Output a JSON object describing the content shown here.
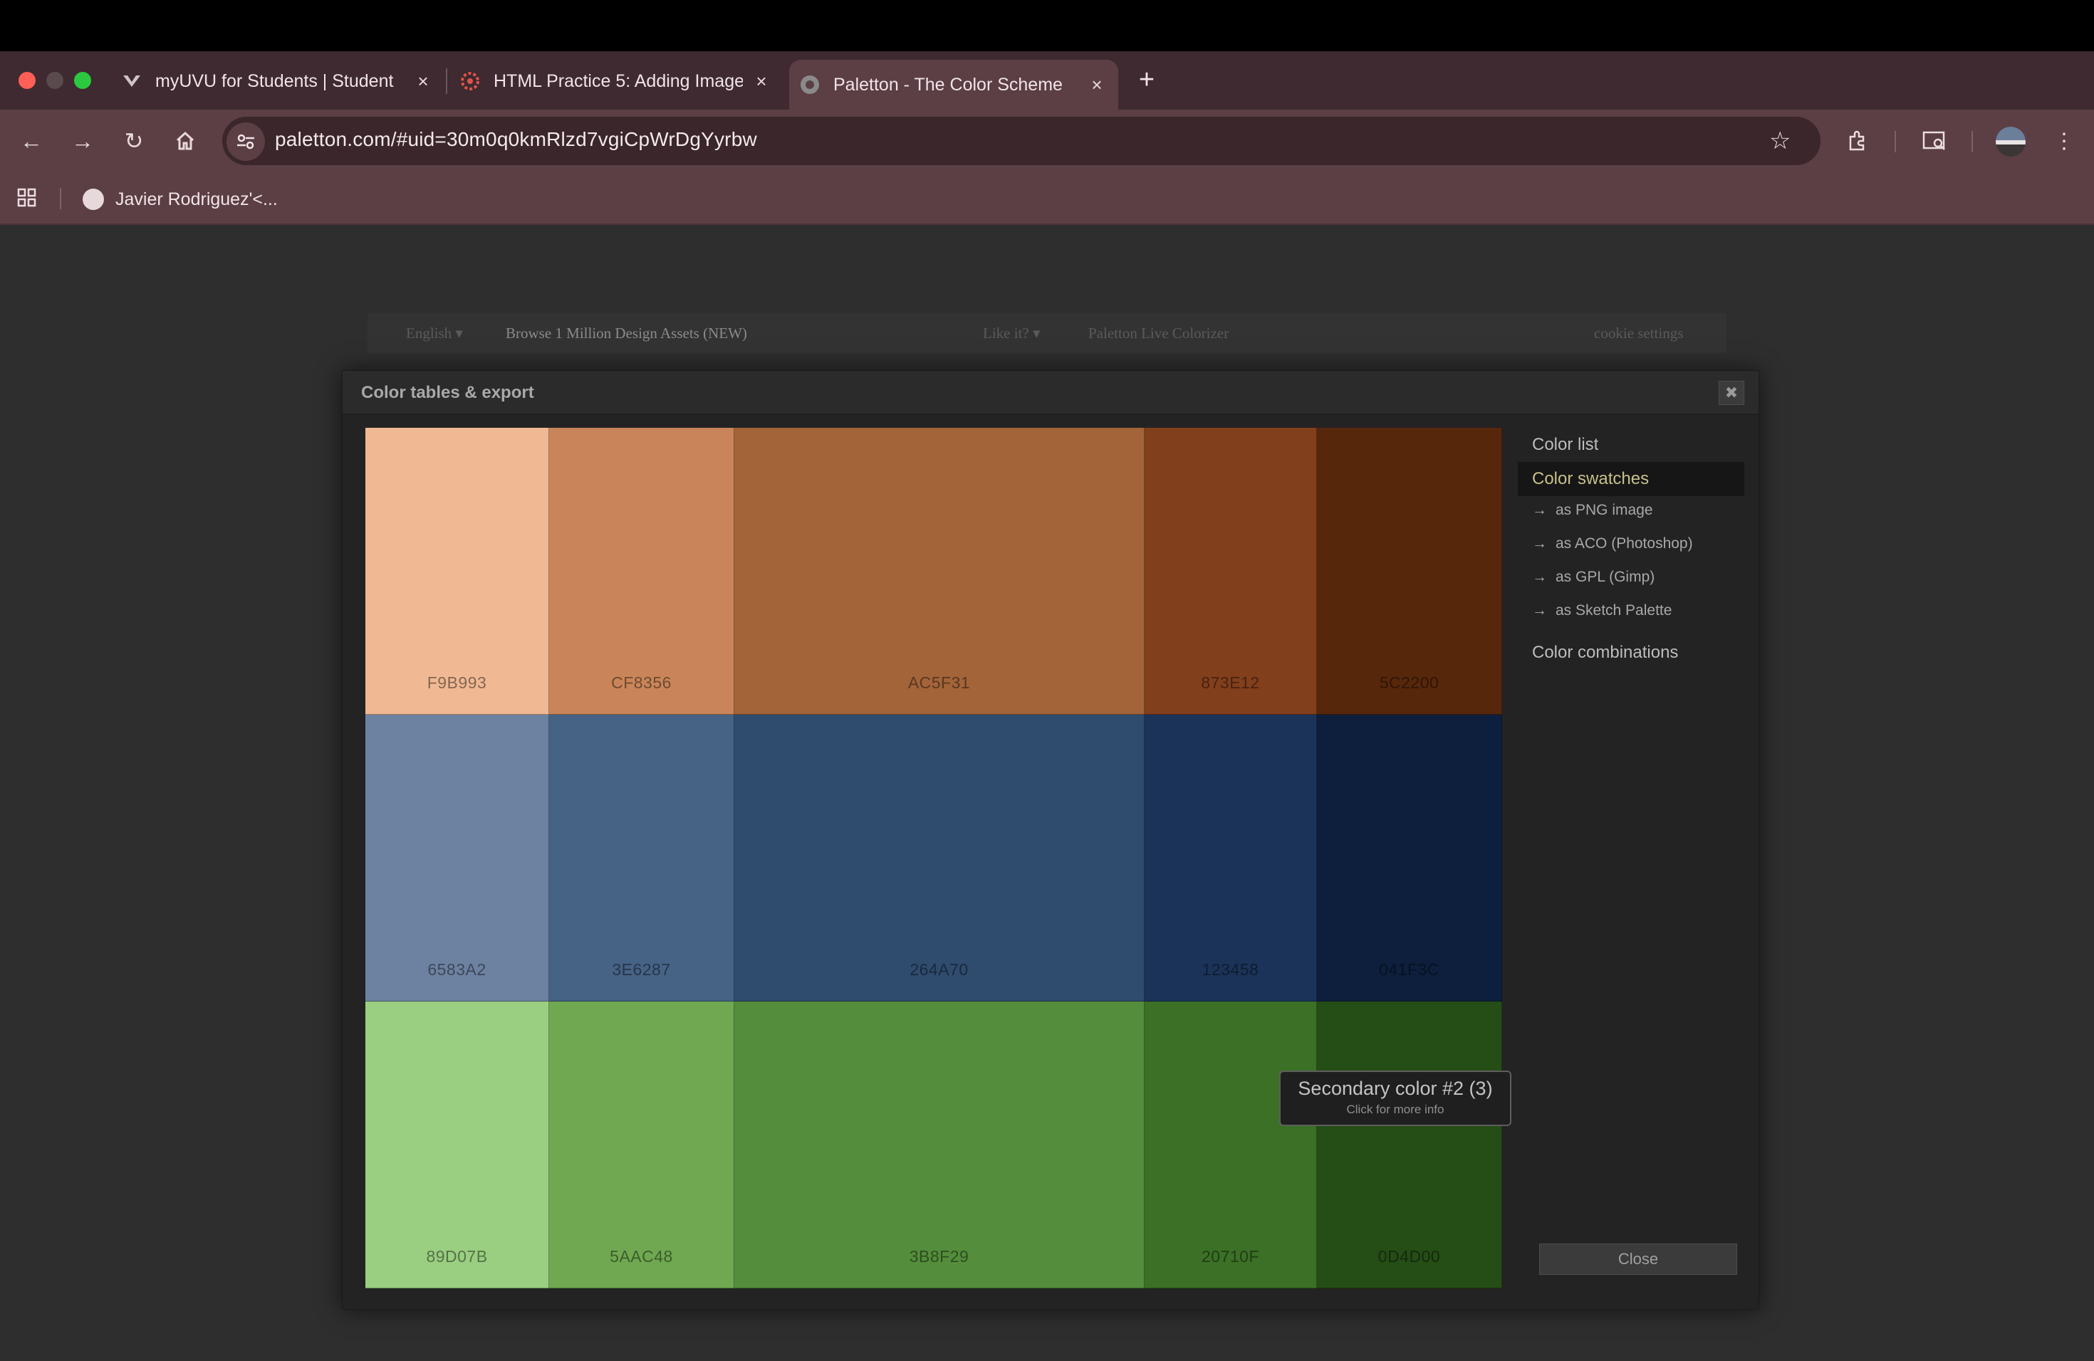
{
  "browser": {
    "tabs": [
      {
        "title": "myUVU for Students | Student",
        "favicon": "uvu-icon"
      },
      {
        "title": "HTML Practice 5: Adding Image",
        "favicon": "canvas-icon"
      },
      {
        "title": "Paletton - The Color Scheme",
        "favicon": "paletton-icon",
        "active": true
      }
    ],
    "url": "paletton.com/#uid=30m0q0kmRlzd7vgiCpWrDgYyrbw",
    "bookmarks": [
      {
        "label": "Javier Rodriguez'<..."
      }
    ]
  },
  "site_nav": {
    "language": "English",
    "assets": "Browse 1 Million Design Assets (NEW)",
    "like": "Like it?",
    "colorizer": "Paletton Live Colorizer",
    "cookie": "cookie settings"
  },
  "modal": {
    "title": "Color tables & export",
    "close_x": "✖",
    "close_label": "Close",
    "sidebar": {
      "color_list": "Color list",
      "color_swatches": "Color swatches",
      "exports": [
        "as PNG image",
        "as ACO (Photoshop)",
        "as GPL (Gimp)",
        "as Sketch Palette"
      ],
      "color_combinations": "Color combinations"
    },
    "swatch_rows": [
      {
        "colors": [
          "F9B993",
          "CF8356",
          "AC5F31",
          "873E12",
          "5C2200"
        ],
        "hex": [
          "#F0B993",
          "#C98559",
          "#A3643A",
          "#823F1C",
          "#57270C"
        ]
      },
      {
        "colors": [
          "6583A2",
          "3E6287",
          "264A70",
          "123458",
          "041F3C"
        ],
        "hex": [
          "#6D82A0",
          "#466285",
          "#2F4B6E",
          "#1B3358",
          "#0D1F3C"
        ]
      },
      {
        "colors": [
          "89D07B",
          "5AAC48",
          "3B8F29",
          "20710F",
          "0D4D00"
        ],
        "hex": [
          "#9ACE81",
          "#6FA851",
          "#548D3B",
          "#3B7026",
          "#254D16"
        ]
      }
    ],
    "tooltip": {
      "title": "Secondary color #2 (3)",
      "subtitle": "Click for more info"
    }
  }
}
